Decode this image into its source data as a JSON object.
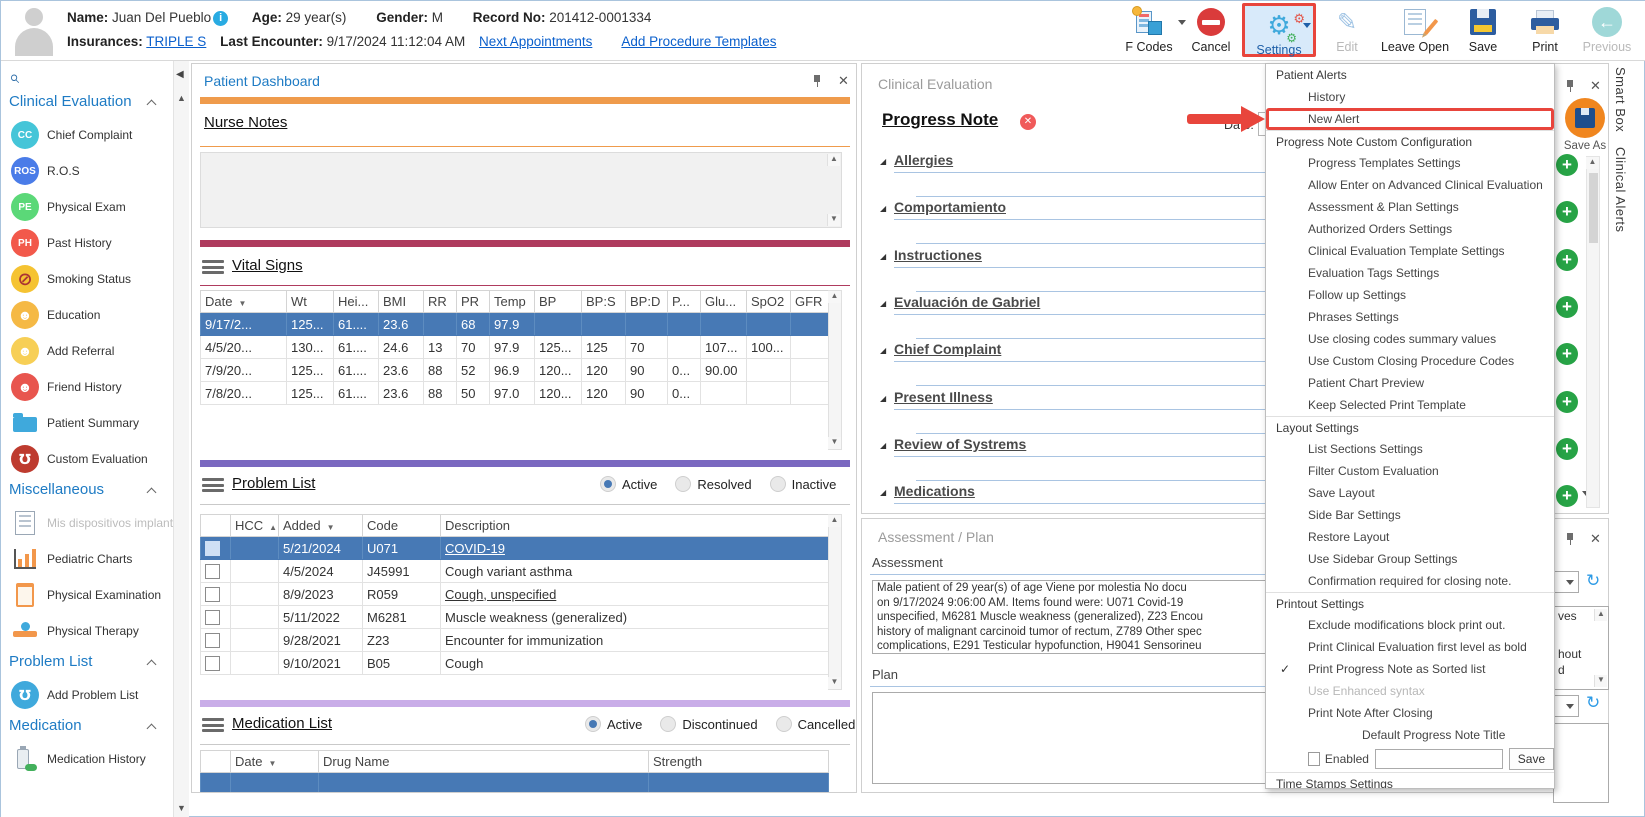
{
  "patient": {
    "name_label": "Name:",
    "name": "Juan Del Pueblo",
    "age_label": "Age:",
    "age": "29 year(s)",
    "gender_label": "Gender:",
    "gender": "M",
    "record_label": "Record No:",
    "record": "201412-0001334",
    "insurances_label": "Insurances:",
    "insurance": "TRIPLE S",
    "last_encounter_label": "Last Encounter:",
    "last_encounter": "9/17/2024 11:12:04 AM",
    "next_appointments": "Next Appointments",
    "add_procedure_templates": "Add Procedure Templates"
  },
  "toolbar": {
    "items": [
      {
        "label": "F Codes"
      },
      {
        "label": "Cancel"
      },
      {
        "label": "Settings"
      },
      {
        "label": "Edit"
      },
      {
        "label": "Leave Open"
      },
      {
        "label": "Save"
      },
      {
        "label": "Print"
      },
      {
        "label": "Previous"
      }
    ]
  },
  "sidebar": {
    "groups": [
      {
        "title": "Clinical Evaluation",
        "items": [
          {
            "label": "Chief Complaint",
            "icon": "cc-badge",
            "badge": "CC",
            "color": "#45c5d8"
          },
          {
            "label": "R.O.S",
            "icon": "ros-badge",
            "badge": "ROS",
            "color": "#4a7ce8"
          },
          {
            "label": "Physical Exam",
            "icon": "pe-badge",
            "badge": "PE",
            "color": "#5bd878"
          },
          {
            "label": "Past History",
            "icon": "ph-badge",
            "badge": "PH",
            "color": "#f2594b"
          },
          {
            "label": "Smoking Status",
            "icon": "no-smoking",
            "badge": "⊘",
            "color": "#f5c332"
          },
          {
            "label": "Education",
            "icon": "education-person",
            "badge": "☻",
            "color": "#f5b945"
          },
          {
            "label": "Add Referral",
            "icon": "referral-doctors",
            "badge": "☻",
            "color": "#f7cf56"
          },
          {
            "label": "Friend History",
            "icon": "family",
            "badge": "☻",
            "color": "#e8554e"
          },
          {
            "label": "Patient Summary",
            "icon": "folder",
            "badge": "",
            "color": ""
          },
          {
            "label": "Custom Evaluation",
            "icon": "stethoscope",
            "badge": "℧",
            "color": "#be3b2f"
          }
        ]
      },
      {
        "title": "Miscellaneous",
        "items": [
          {
            "label": "Mis dispositivos implanta",
            "icon": "certificate-doc",
            "disabled": true
          },
          {
            "label": "Pediatric Charts",
            "icon": "growth-chart"
          },
          {
            "label": "Physical Examination",
            "icon": "clipboard"
          },
          {
            "label": "Physical Therapy",
            "icon": "therapy"
          }
        ]
      },
      {
        "title": "Problem List",
        "items": [
          {
            "label": "Add Problem List",
            "icon": "stethoscope",
            "badge": "℧",
            "color": "#3fa9dc"
          }
        ]
      },
      {
        "title": "Medication",
        "items": [
          {
            "label": "Medication History",
            "icon": "medication-bottle"
          }
        ]
      }
    ]
  },
  "dashboard": {
    "panel_title": "Patient Dashboard",
    "nurse_notes_title": "Nurse Notes",
    "vital_signs": {
      "title": "Vital Signs",
      "columns": [
        "Date",
        "Wt",
        "Hei...",
        "BMI",
        "RR",
        "PR",
        "Temp",
        "BP",
        "BP:S",
        "BP:D",
        "P...",
        "Glu...",
        "SpO2",
        "GFR"
      ],
      "rows": [
        [
          "9/17/2...",
          "125...",
          "61....",
          "23.6",
          "",
          "68",
          "97.9",
          "",
          "",
          "",
          "",
          "",
          "",
          ""
        ],
        [
          "4/5/20...",
          "130...",
          "61....",
          "24.6",
          "13",
          "70",
          "97.9",
          "125...",
          "125",
          "70",
          "",
          "107...",
          "100...",
          ""
        ],
        [
          "7/9/20...",
          "125...",
          "61....",
          "23.6",
          "88",
          "52",
          "96.9",
          "120...",
          "120",
          "90",
          "0...",
          "90.00",
          "",
          ""
        ],
        [
          "7/8/20...",
          "125...",
          "61....",
          "23.6",
          "88",
          "50",
          "97.0",
          "120...",
          "120",
          "90",
          "0...",
          "",
          "",
          ""
        ]
      ],
      "selected_row": 0
    },
    "problem_list": {
      "title": "Problem List",
      "filters": [
        "Active",
        "Resolved",
        "Inactive"
      ],
      "selected_filter": 0,
      "columns": [
        "HCC",
        "Added",
        "Code",
        "Description"
      ],
      "rows": [
        {
          "added": "5/21/2024",
          "code": "U071",
          "desc": "COVID-19",
          "link": true,
          "selected": true
        },
        {
          "added": "4/5/2024",
          "code": "J45991",
          "desc": "Cough variant asthma"
        },
        {
          "added": "8/9/2023",
          "code": "R059",
          "desc": "Cough, unspecified",
          "link": true
        },
        {
          "added": "5/11/2022",
          "code": "M6281",
          "desc": "Muscle weakness (generalized)"
        },
        {
          "added": "9/28/2021",
          "code": "Z23",
          "desc": "Encounter for immunization"
        },
        {
          "added": "9/10/2021",
          "code": "B05",
          "desc": "Cough"
        }
      ]
    },
    "medication_list": {
      "title": "Medication List",
      "filters": [
        "Active",
        "Discontinued",
        "Cancelled"
      ],
      "selected_filter": 0,
      "columns": [
        "Date",
        "Drug Name",
        "Strength"
      ]
    }
  },
  "evaluation": {
    "panel_title": "Clinical Evaluation",
    "note_title": "Progress Note",
    "date_label": "Date:",
    "save_as_label": "Save As",
    "sections": [
      "Allergies",
      "Comportamiento",
      "Instructiones",
      "Evaluación de Gabriel",
      "Chief Complaint",
      "Present Illness",
      "Review of Systrems",
      "Medications"
    ]
  },
  "assessment_plan": {
    "panel_title": "Assessment / Plan",
    "assessment_label": "Assessment",
    "plan_label": "Plan",
    "assessment_lines": [
      "Male patient of 29 year(s) of age Viene por molestia    No docu",
      "on 9/17/2024 9:06:00 AM.    Items found were:  U071 Covid-19",
      "unspecified, M6281 Muscle weakness (generalized), Z23 Encou",
      "history of malignant carcinoid tumor of rectum, Z789 Other spec",
      "complications, E291 Testicular hypofunction, H9041 Sensorineu"
    ]
  },
  "right_rail": {
    "tabs": [
      "Smart Box",
      "Clinical Alerts"
    ],
    "listbox_fragments": [
      "ves",
      "hout",
      "d"
    ]
  },
  "settings_menu": {
    "items": [
      {
        "type": "header",
        "label": "Patient Alerts"
      },
      {
        "type": "item",
        "label": "History"
      },
      {
        "type": "item",
        "label": "New Alert",
        "highlighted": true
      },
      {
        "type": "header",
        "label": "Progress Note Custom Configuration",
        "separator": true
      },
      {
        "type": "item",
        "label": "Progress Templates Settings"
      },
      {
        "type": "item",
        "label": "Allow Enter on Advanced Clinical Evaluation"
      },
      {
        "type": "item",
        "label": "Assessment & Plan Settings"
      },
      {
        "type": "item",
        "label": "Authorized Orders Settings"
      },
      {
        "type": "item",
        "label": "Clinical Evaluation Template Settings"
      },
      {
        "type": "item",
        "label": "Evaluation Tags Settings"
      },
      {
        "type": "item",
        "label": "Follow up Settings"
      },
      {
        "type": "item",
        "label": "Phrases Settings"
      },
      {
        "type": "item",
        "label": "Use closing codes summary values"
      },
      {
        "type": "item",
        "label": "Use Custom Closing Procedure Codes"
      },
      {
        "type": "item",
        "label": "Patient Chart Preview"
      },
      {
        "type": "item",
        "label": "Keep Selected Print Template"
      },
      {
        "type": "header",
        "label": "Layout Settings",
        "separator": true
      },
      {
        "type": "item",
        "label": "List Sections Settings"
      },
      {
        "type": "item",
        "label": "Filter Custom Evaluation"
      },
      {
        "type": "item",
        "label": "Save Layout"
      },
      {
        "type": "item",
        "label": "Side Bar Settings"
      },
      {
        "type": "item",
        "label": "Restore Layout"
      },
      {
        "type": "item",
        "label": "Use Sidebar Group Settings"
      },
      {
        "type": "item",
        "label": "Confirmation required for closing note."
      },
      {
        "type": "header",
        "label": "Printout Settings",
        "separator": true
      },
      {
        "type": "item",
        "label": "Exclude modifications block print out."
      },
      {
        "type": "item",
        "label": "Print Clinical Evaluation first level as bold"
      },
      {
        "type": "item",
        "label": "Print Progress Note as Sorted list",
        "checked": true
      },
      {
        "type": "item",
        "label": "Use Enhanced syntax",
        "disabled": true
      },
      {
        "type": "item",
        "label": "Print Note After Closing"
      },
      {
        "type": "subtitle",
        "label": "Default Progress Note Title"
      },
      {
        "type": "enabled-row",
        "label": "Enabled",
        "save_label": "Save"
      },
      {
        "type": "header",
        "label": "Time Stamps Settings",
        "separator": true
      }
    ]
  }
}
